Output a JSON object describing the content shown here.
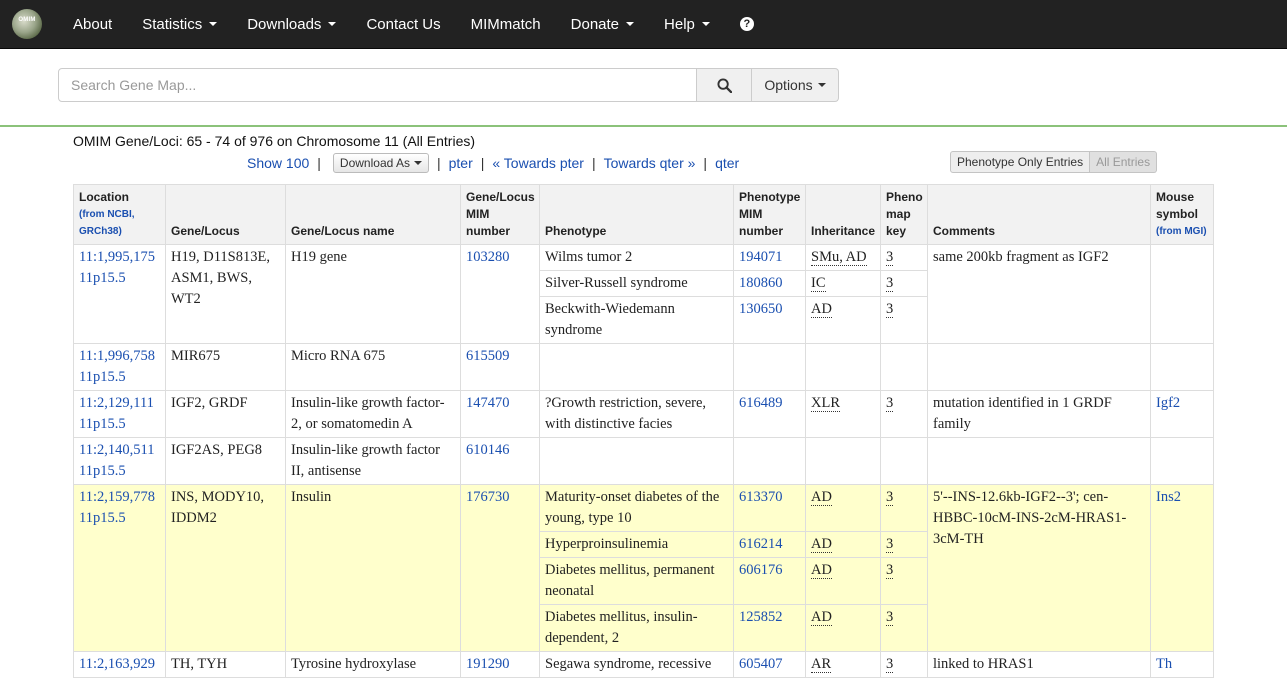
{
  "nav": {
    "logo_text": "OMIM",
    "items": [
      {
        "label": "About",
        "dropdown": false
      },
      {
        "label": "Statistics",
        "dropdown": true
      },
      {
        "label": "Downloads",
        "dropdown": true
      },
      {
        "label": "Contact Us",
        "dropdown": false
      },
      {
        "label": "MIMmatch",
        "dropdown": false
      },
      {
        "label": "Donate",
        "dropdown": true
      },
      {
        "label": "Help",
        "dropdown": true
      }
    ],
    "help_icon": "question-circle-icon"
  },
  "search": {
    "placeholder": "Search Gene Map...",
    "value": "",
    "search_icon": "search-icon",
    "options_label": "Options"
  },
  "results": {
    "heading": "OMIM Gene/Loci: 65 - 74 of 976 on Chromosome 11 (All Entries)",
    "show_label": "Show 100",
    "download_label": "Download As",
    "pter": "pter",
    "towards_pter": "« Towards pter",
    "towards_qter": "Towards qter »",
    "qter": "qter",
    "toggle_phenotype": "Phenotype Only Entries",
    "toggle_all": "All Entries"
  },
  "columns": {
    "location": "Location",
    "location_sub": "(from NCBI, GRCh38)",
    "gene_locus": "Gene/Locus",
    "gene_name": "Gene/Locus name",
    "mim_number": "Gene/Locus MIM number",
    "phenotype": "Phenotype",
    "pheno_mim": "Phenotype MIM number",
    "inheritance": "Inheritance",
    "pheno_key": "Pheno map key",
    "comments": "Comments",
    "mouse": "Mouse symbol",
    "mouse_sub": "(from MGI)"
  },
  "rows": [
    {
      "location": "11:1,995,175",
      "cyto": "11p15.5",
      "gene": "H19, D11S813E, ASM1, BWS, WT2",
      "name": "H19 gene",
      "mim": "103280",
      "comment": "same 200kb fragment as IGF2",
      "mouse": "",
      "highlight": false,
      "phenotypes": [
        {
          "name": "Wilms tumor 2",
          "mim": "194071",
          "inheritance": "SMu, AD",
          "key": "3"
        },
        {
          "name": "Silver-Russell syndrome",
          "mim": "180860",
          "inheritance": "IC",
          "key": "3"
        },
        {
          "name": "Beckwith-Wiedemann syndrome",
          "mim": "130650",
          "inheritance": "AD",
          "key": "3"
        }
      ]
    },
    {
      "location": "11:1,996,758",
      "cyto": "11p15.5",
      "gene": "MIR675",
      "name": "Micro RNA 675",
      "mim": "615509",
      "comment": "",
      "mouse": "",
      "highlight": false,
      "phenotypes": []
    },
    {
      "location": "11:2,129,111",
      "cyto": "11p15.5",
      "gene": "IGF2, GRDF",
      "name": "Insulin-like growth factor-2, or somatomedin A",
      "mim": "147470",
      "comment": "mutation identified in 1 GRDF family",
      "mouse": "Igf2",
      "highlight": false,
      "phenotypes": [
        {
          "name": "?Growth restriction, severe, with distinctive facies",
          "mim": "616489",
          "inheritance": "XLR",
          "key": "3"
        }
      ]
    },
    {
      "location": "11:2,140,511",
      "cyto": "11p15.5",
      "gene": "IGF2AS, PEG8",
      "name": "Insulin-like growth factor II, antisense",
      "mim": "610146",
      "comment": "",
      "mouse": "",
      "highlight": false,
      "phenotypes": []
    },
    {
      "location": "11:2,159,778",
      "cyto": "11p15.5",
      "gene": "INS, MODY10, IDDM2",
      "name": "Insulin",
      "mim": "176730",
      "comment": "5'--INS-12.6kb-IGF2--3'; cen-HBBC-10cM-INS-2cM-HRAS1-3cM-TH",
      "mouse": "Ins2",
      "highlight": true,
      "phenotypes": [
        {
          "name": "Maturity-onset diabetes of the young, type 10",
          "mim": "613370",
          "inheritance": "AD",
          "key": "3"
        },
        {
          "name": "Hyperproinsulinemia",
          "mim": "616214",
          "inheritance": "AD",
          "key": "3"
        },
        {
          "name": "Diabetes mellitus, permanent neonatal",
          "mim": "606176",
          "inheritance": "AD",
          "key": "3"
        },
        {
          "name": "Diabetes mellitus, insulin-dependent, 2",
          "mim": "125852",
          "inheritance": "AD",
          "key": "3"
        }
      ]
    },
    {
      "location": "11:2,163,929",
      "cyto": "",
      "gene": "TH, TYH",
      "name": "Tyrosine hydroxylase",
      "mim": "191290",
      "comment": "linked to HRAS1",
      "mouse": "Th",
      "highlight": false,
      "phenotypes": [
        {
          "name": "Segawa syndrome, recessive",
          "mim": "605407",
          "inheritance": "AR",
          "key": "3"
        }
      ]
    }
  ]
}
